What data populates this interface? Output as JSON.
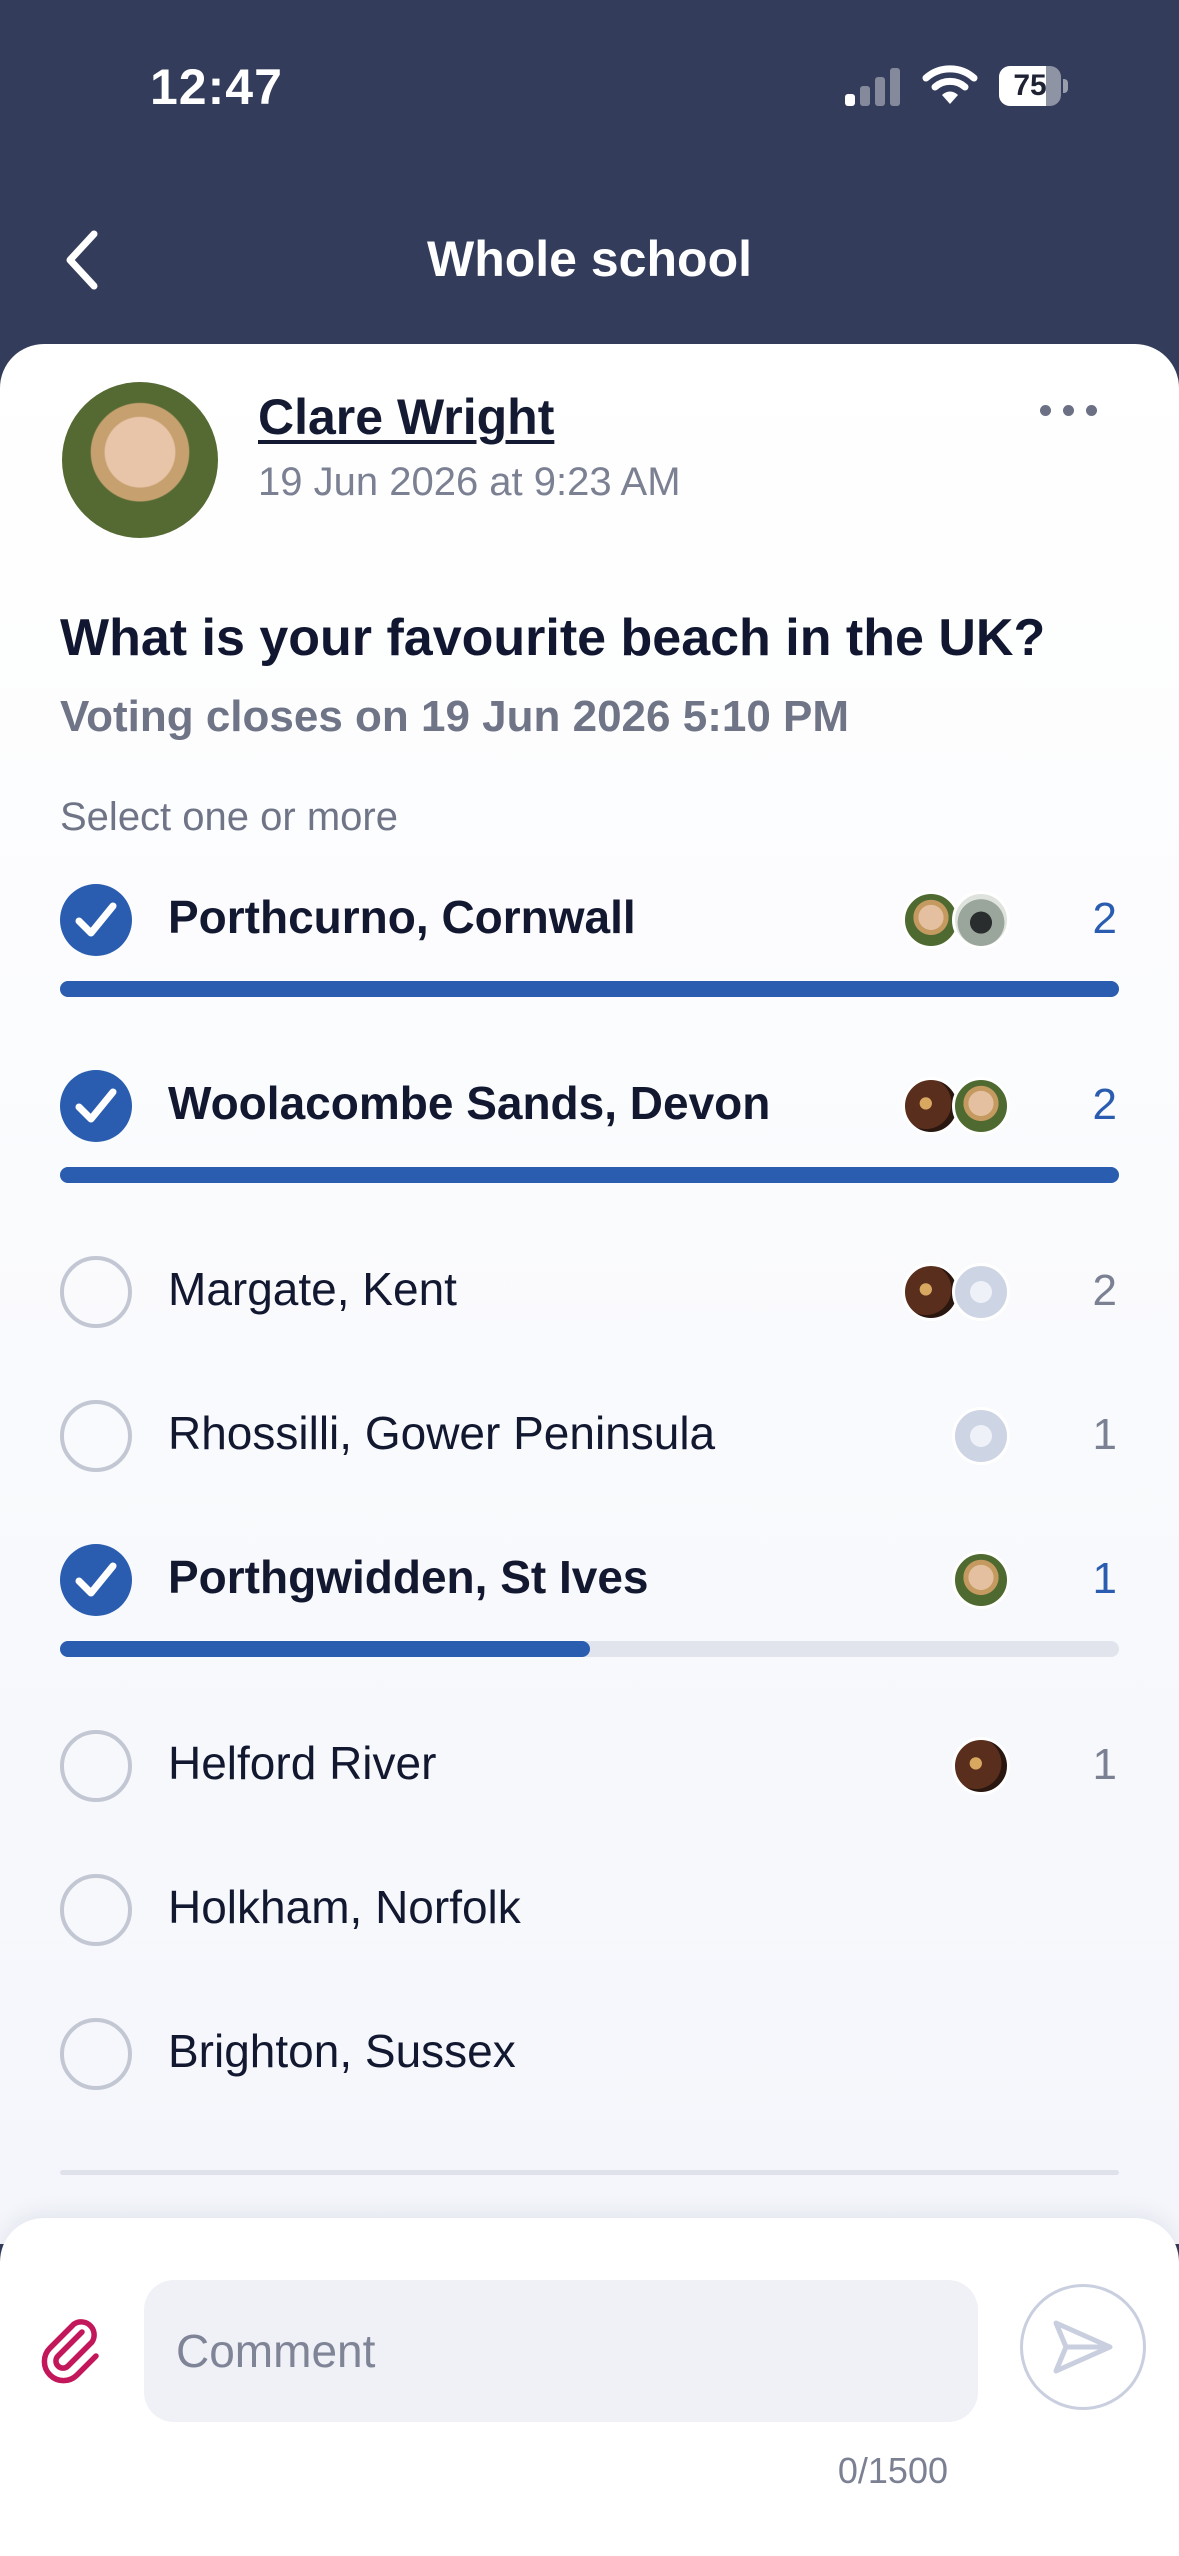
{
  "status_bar": {
    "time": "12:47",
    "battery_level": 75,
    "battery_text": "75"
  },
  "header": {
    "title": "Whole school",
    "back_icon": "chevron-left-icon"
  },
  "post": {
    "author": "Clare Wright",
    "date": "19 Jun 2026 at 9:23 AM",
    "question": "What is your favourite beach in the UK?",
    "closes": "Voting closes on 19 Jun 2026 5:10 PM",
    "hint": "Select one or more",
    "options": [
      {
        "label": "Porthcurno, Cornwall",
        "selected": true,
        "count": "2",
        "bar_fraction": 1.0
      },
      {
        "label": "Woolacombe Sands, Devon",
        "selected": true,
        "count": "2",
        "bar_fraction": 1.0
      },
      {
        "label": "Margate, Kent",
        "selected": false,
        "count": "2"
      },
      {
        "label": "Rhossilli, Gower Peninsula",
        "selected": false,
        "count": "1"
      },
      {
        "label": "Porthgwidden, St Ives",
        "selected": true,
        "count": "1",
        "bar_fraction": 0.5
      },
      {
        "label": "Helford River",
        "selected": false,
        "count": "1"
      },
      {
        "label": "Holkham, Norfolk",
        "selected": false,
        "count": ""
      },
      {
        "label": "Brighton, Sussex",
        "selected": false,
        "count": ""
      }
    ]
  },
  "composer": {
    "placeholder": "Comment",
    "char_count": "0/1500",
    "attach_icon": "paperclip-icon",
    "send_icon": "send-icon"
  },
  "colors": {
    "header_bg": "#333c5b",
    "accent": "#2a5db0",
    "attach": "#c2185b"
  }
}
